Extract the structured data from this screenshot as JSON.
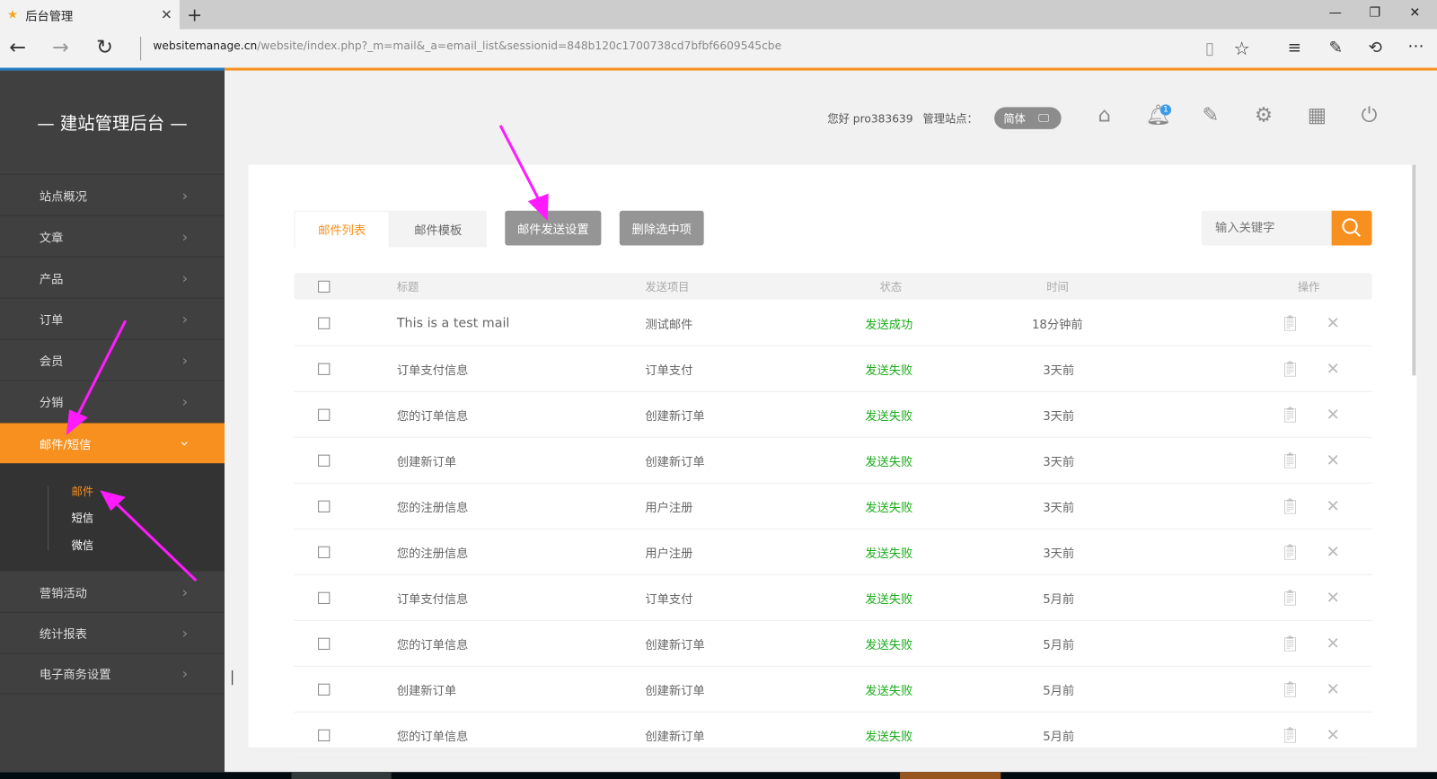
{
  "browser": {
    "tab_title": "后台管理",
    "url_host": "websitemanage.cn",
    "url_path": "/website/index.php?_m=mail&_a=email_list&sessionid=848b120c1700738cd7bfbf6609545cbe"
  },
  "sidebar": {
    "brand": "— 建站管理后台 —",
    "items": [
      {
        "label": "站点概况"
      },
      {
        "label": "文章"
      },
      {
        "label": "产品"
      },
      {
        "label": "订单"
      },
      {
        "label": "会员"
      },
      {
        "label": "分销"
      },
      {
        "label": "邮件/短信",
        "active": true
      },
      {
        "label": "营销活动"
      },
      {
        "label": "统计报表"
      },
      {
        "label": "电子商务设置"
      }
    ],
    "subitems": [
      {
        "label": "邮件",
        "active": true
      },
      {
        "label": "短信"
      },
      {
        "label": "微信"
      }
    ]
  },
  "header": {
    "greeting": "您好 pro383639",
    "site_label": "管理站点：",
    "lang": "简体",
    "notification_count": "1"
  },
  "toolbar": {
    "tabs": [
      {
        "label": "邮件列表",
        "active": true
      },
      {
        "label": "邮件模板"
      }
    ],
    "send_settings": "邮件发送设置",
    "delete_selected": "删除选中项",
    "search_placeholder": "输入关键字"
  },
  "table": {
    "headers": {
      "title": "标题",
      "item": "发送项目",
      "status": "状态",
      "time": "时间",
      "actions": "操作"
    },
    "rows": [
      {
        "title": "This is a test mail",
        "item": "测试邮件",
        "status": "发送成功",
        "time": "18分钟前"
      },
      {
        "title": "订单支付信息",
        "item": "订单支付",
        "status": "发送失败",
        "time": "3天前"
      },
      {
        "title": "您的订单信息",
        "item": "创建新订单",
        "status": "发送失败",
        "time": "3天前"
      },
      {
        "title": "创建新订单",
        "item": "创建新订单",
        "status": "发送失败",
        "time": "3天前"
      },
      {
        "title": "您的注册信息",
        "item": "用户注册",
        "status": "发送失败",
        "time": "3天前"
      },
      {
        "title": "您的注册信息",
        "item": "用户注册",
        "status": "发送失败",
        "time": "3天前"
      },
      {
        "title": "订单支付信息",
        "item": "订单支付",
        "status": "发送失败",
        "time": "5月前"
      },
      {
        "title": "您的订单信息",
        "item": "创建新订单",
        "status": "发送失败",
        "time": "5月前"
      },
      {
        "title": "创建新订单",
        "item": "创建新订单",
        "status": "发送失败",
        "time": "5月前"
      },
      {
        "title": "您的订单信息",
        "item": "创建新订单",
        "status": "发送失败",
        "time": "5月前"
      }
    ]
  },
  "colors": {
    "accent": "#f7901e",
    "success": "#1aad19",
    "sidebar": "#404040",
    "annotation": "#ff1aff"
  }
}
